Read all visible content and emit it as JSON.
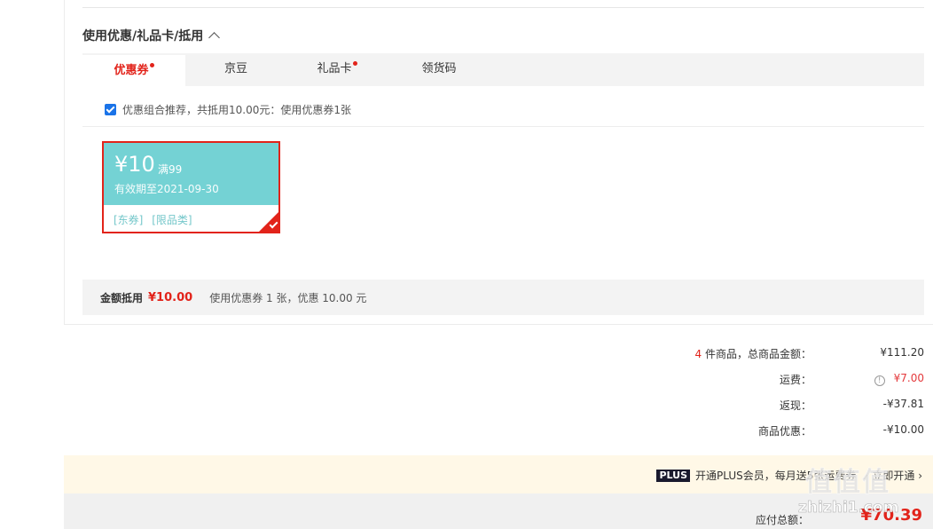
{
  "section": {
    "title": "使用优惠/礼品卡/抵用"
  },
  "tabs": [
    {
      "label": "优惠券",
      "active": true,
      "dot": true
    },
    {
      "label": "京豆",
      "active": false,
      "dot": false
    },
    {
      "label": "礼品卡",
      "active": false,
      "dot": true
    },
    {
      "label": "领货码",
      "active": false,
      "dot": false
    }
  ],
  "combo": {
    "checked": true,
    "text": "优惠组合推荐，共抵用10.00元：使用优惠券1张"
  },
  "coupon": {
    "amount": "¥10",
    "condition": "满99",
    "valid": "有效期至2021-09-30",
    "tags": [
      "[东券]",
      "[限品类]"
    ],
    "selected": true,
    "color": "#74d2d4"
  },
  "summary": {
    "label": "金额抵用",
    "amount": "¥10.00",
    "desc": "使用优惠券 1 张，优惠 10.00 元"
  },
  "totals": {
    "count": "4",
    "goods_label": "件商品，总商品金额：",
    "goods_value": "¥111.20",
    "shipping_label": "运费：",
    "shipping_icon": "!",
    "shipping_value": "¥7.00",
    "cashback_label": "返现：",
    "cashback_value": "-¥37.81",
    "discount_label": "商品优惠：",
    "discount_value": "-¥10.00"
  },
  "plus": {
    "badge": "PLUS",
    "text": "开通PLUS会员，每月送5张运费券",
    "link": "立即开通 ›"
  },
  "payable": {
    "label": "应付总额：",
    "amount": "¥70.39"
  },
  "watermark": {
    "glyphs": "值值值",
    "url": "zhizhi1.com"
  },
  "colors": {
    "accent": "#e2231a",
    "coupon": "#74d2d4",
    "plus_bg": "#fff8e7"
  }
}
